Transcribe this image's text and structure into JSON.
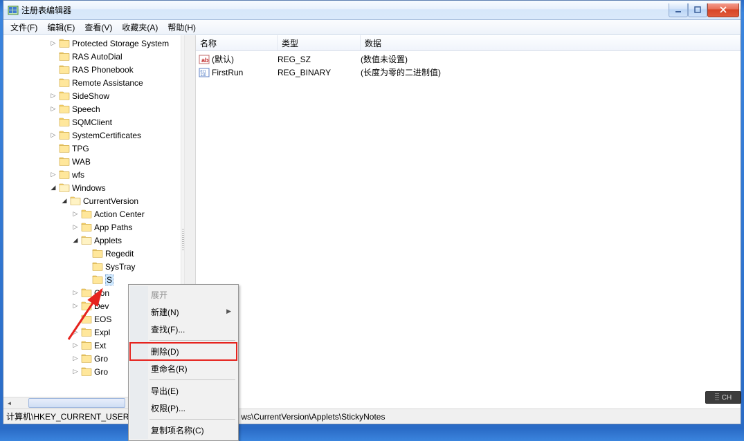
{
  "window": {
    "title": "注册表编辑器"
  },
  "menu": {
    "file": "文件(F)",
    "edit": "编辑(E)",
    "view": "查看(V)",
    "fav": "收藏夹(A)",
    "help": "帮助(H)"
  },
  "tree": {
    "items": [
      {
        "depth": 4,
        "exp": ">",
        "label": "Protected Storage System"
      },
      {
        "depth": 4,
        "exp": "",
        "label": "RAS AutoDial"
      },
      {
        "depth": 4,
        "exp": "",
        "label": "RAS Phonebook"
      },
      {
        "depth": 4,
        "exp": "",
        "label": "Remote Assistance"
      },
      {
        "depth": 4,
        "exp": ">",
        "label": "SideShow"
      },
      {
        "depth": 4,
        "exp": ">",
        "label": "Speech"
      },
      {
        "depth": 4,
        "exp": "",
        "label": "SQMClient"
      },
      {
        "depth": 4,
        "exp": ">",
        "label": "SystemCertificates"
      },
      {
        "depth": 4,
        "exp": "",
        "label": "TPG"
      },
      {
        "depth": 4,
        "exp": "",
        "label": "WAB"
      },
      {
        "depth": 4,
        "exp": ">",
        "label": "wfs"
      },
      {
        "depth": 4,
        "exp": "v",
        "label": "Windows",
        "open": true
      },
      {
        "depth": 5,
        "exp": "v",
        "label": "CurrentVersion",
        "open": true
      },
      {
        "depth": 6,
        "exp": ">",
        "label": "Action Center"
      },
      {
        "depth": 6,
        "exp": ">",
        "label": "App Paths"
      },
      {
        "depth": 6,
        "exp": "v",
        "label": "Applets",
        "open": true
      },
      {
        "depth": 7,
        "exp": "",
        "label": "Regedit"
      },
      {
        "depth": 7,
        "exp": "",
        "label": "SysTray"
      },
      {
        "depth": 7,
        "exp": "",
        "label": "S",
        "selected": true
      },
      {
        "depth": 6,
        "exp": ">",
        "label": "Con"
      },
      {
        "depth": 6,
        "exp": ">",
        "label": "Dev"
      },
      {
        "depth": 6,
        "exp": "",
        "label": "EOS"
      },
      {
        "depth": 6,
        "exp": ">",
        "label": "Expl"
      },
      {
        "depth": 6,
        "exp": ">",
        "label": "Ext"
      },
      {
        "depth": 6,
        "exp": ">",
        "label": "Gro"
      },
      {
        "depth": 6,
        "exp": ">",
        "label": "Gro"
      }
    ]
  },
  "list": {
    "cols": {
      "name": "名称",
      "type": "类型",
      "data": "数据"
    },
    "rows": [
      {
        "icon": "str",
        "name": "(默认)",
        "type": "REG_SZ",
        "data": "(数值未设置)"
      },
      {
        "icon": "bin",
        "name": "FirstRun",
        "type": "REG_BINARY",
        "data": "(长度为零的二进制值)"
      }
    ]
  },
  "ctx": {
    "expand": "展开",
    "new": "新建(N)",
    "find": "查找(F)...",
    "delete": "删除(D)",
    "rename": "重命名(R)",
    "export": "导出(E)",
    "perm": "权限(P)...",
    "copyname": "复制项名称(C)"
  },
  "status": {
    "path_left": "计算机\\HKEY_CURRENT_USER",
    "path_right": "ws\\CurrentVersion\\Applets\\StickyNotes"
  },
  "ime": {
    "label": "CH"
  }
}
